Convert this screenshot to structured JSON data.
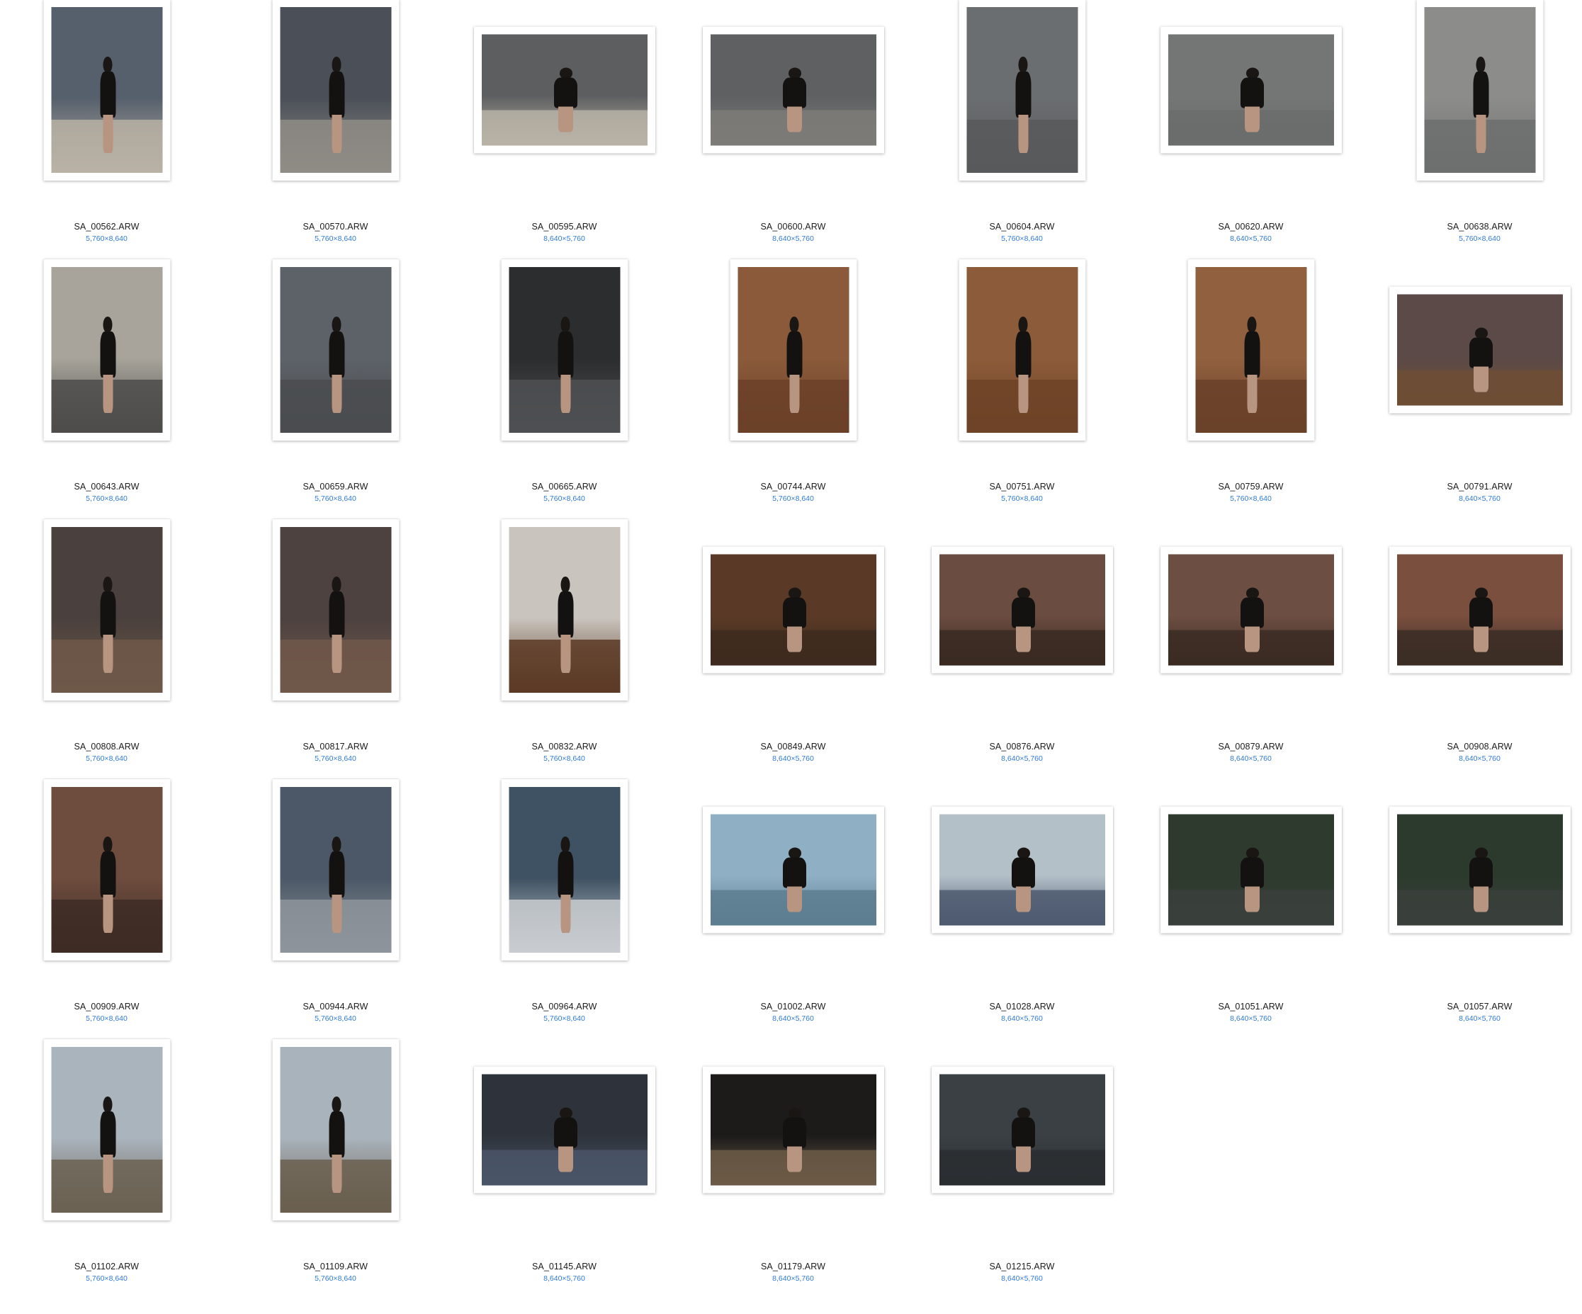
{
  "files": [
    {
      "name": "SA_00562.ARW",
      "dimensions": "5,760×8,640",
      "orientation": "portrait",
      "palette": [
        "#56606c",
        "#b9b2a5"
      ]
    },
    {
      "name": "SA_00570.ARW",
      "dimensions": "5,760×8,640",
      "orientation": "portrait",
      "palette": [
        "#4b5058",
        "#8f8c86"
      ]
    },
    {
      "name": "SA_00595.ARW",
      "dimensions": "8,640×5,760",
      "orientation": "landscape",
      "palette": [
        "#5d5e60",
        "#b9b3a7"
      ]
    },
    {
      "name": "SA_00600.ARW",
      "dimensions": "8,640×5,760",
      "orientation": "landscape",
      "palette": [
        "#5e6062",
        "#7c7b78"
      ]
    },
    {
      "name": "SA_00604.ARW",
      "dimensions": "5,760×8,640",
      "orientation": "portrait",
      "palette": [
        "#6b6e70",
        "#58595a"
      ]
    },
    {
      "name": "SA_00620.ARW",
      "dimensions": "8,640×5,760",
      "orientation": "landscape",
      "palette": [
        "#747675",
        "#6b6c6c"
      ]
    },
    {
      "name": "SA_00638.ARW",
      "dimensions": "5,760×8,640",
      "orientation": "portrait",
      "palette": [
        "#8c8d8b",
        "#6d6e6e"
      ]
    },
    {
      "name": "SA_00643.ARW",
      "dimensions": "5,760×8,640",
      "orientation": "portrait",
      "palette": [
        "#a8a49b",
        "#4d4c4b"
      ]
    },
    {
      "name": "SA_00659.ARW",
      "dimensions": "5,760×8,640",
      "orientation": "portrait",
      "palette": [
        "#5d6268",
        "#4a4c4f"
      ]
    },
    {
      "name": "SA_00665.ARW",
      "dimensions": "5,760×8,640",
      "orientation": "portrait",
      "palette": [
        "#2c2d2e",
        "#4e5052"
      ]
    },
    {
      "name": "SA_00744.ARW",
      "dimensions": "5,760×8,640",
      "orientation": "portrait",
      "palette": [
        "#8a5a3a",
        "#6b4128"
      ]
    },
    {
      "name": "SA_00751.ARW",
      "dimensions": "5,760×8,640",
      "orientation": "portrait",
      "palette": [
        "#8c5b3a",
        "#6e4327"
      ]
    },
    {
      "name": "SA_00759.ARW",
      "dimensions": "5,760×8,640",
      "orientation": "portrait",
      "palette": [
        "#91603f",
        "#6a4129"
      ]
    },
    {
      "name": "SA_00791.ARW",
      "dimensions": "8,640×5,760",
      "orientation": "landscape",
      "palette": [
        "#5b4a48",
        "#6e4d35"
      ]
    },
    {
      "name": "SA_00808.ARW",
      "dimensions": "5,760×8,640",
      "orientation": "portrait",
      "palette": [
        "#4a403d",
        "#6e5849"
      ]
    },
    {
      "name": "SA_00817.ARW",
      "dimensions": "5,760×8,640",
      "orientation": "portrait",
      "palette": [
        "#4d4240",
        "#70584a"
      ]
    },
    {
      "name": "SA_00832.ARW",
      "dimensions": "5,760×8,640",
      "orientation": "portrait",
      "palette": [
        "#c9c4bd",
        "#5c3a25"
      ]
    },
    {
      "name": "SA_00849.ARW",
      "dimensions": "8,640×5,760",
      "orientation": "landscape",
      "palette": [
        "#5a3a26",
        "#3e2a1e"
      ]
    },
    {
      "name": "SA_00876.ARW",
      "dimensions": "8,640×5,760",
      "orientation": "landscape",
      "palette": [
        "#6b4c40",
        "#3a2a22"
      ]
    },
    {
      "name": "SA_00879.ARW",
      "dimensions": "8,640×5,760",
      "orientation": "landscape",
      "palette": [
        "#6d4e42",
        "#3b2b23"
      ]
    },
    {
      "name": "SA_00908.ARW",
      "dimensions": "8,640×5,760",
      "orientation": "landscape",
      "palette": [
        "#7a4f3e",
        "#3b2d25"
      ]
    },
    {
      "name": "SA_00909.ARW",
      "dimensions": "5,760×8,640",
      "orientation": "portrait",
      "palette": [
        "#6e4c3e",
        "#3d2c24"
      ]
    },
    {
      "name": "SA_00944.ARW",
      "dimensions": "5,760×8,640",
      "orientation": "portrait",
      "palette": [
        "#4c5867",
        "#8e949b"
      ]
    },
    {
      "name": "SA_00964.ARW",
      "dimensions": "5,760×8,640",
      "orientation": "portrait",
      "palette": [
        "#3f5263",
        "#c9ccd0"
      ]
    },
    {
      "name": "SA_01002.ARW",
      "dimensions": "8,640×5,760",
      "orientation": "landscape",
      "palette": [
        "#8fb0c4",
        "#5d7c90"
      ]
    },
    {
      "name": "SA_01028.ARW",
      "dimensions": "8,640×5,760",
      "orientation": "landscape",
      "palette": [
        "#b4c0c8",
        "#4d5a70"
      ]
    },
    {
      "name": "SA_01051.ARW",
      "dimensions": "8,640×5,760",
      "orientation": "landscape",
      "palette": [
        "#2d3a2d",
        "#3a3f3c"
      ]
    },
    {
      "name": "SA_01057.ARW",
      "dimensions": "8,640×5,760",
      "orientation": "landscape",
      "palette": [
        "#2c3a2d",
        "#393f3b"
      ]
    },
    {
      "name": "SA_01102.ARW",
      "dimensions": "5,760×8,640",
      "orientation": "portrait",
      "palette": [
        "#aab4bd",
        "#6b6152"
      ]
    },
    {
      "name": "SA_01109.ARW",
      "dimensions": "5,760×8,640",
      "orientation": "portrait",
      "palette": [
        "#a9b3bc",
        "#6a5f4f"
      ]
    },
    {
      "name": "SA_01145.ARW",
      "dimensions": "8,640×5,760",
      "orientation": "landscape",
      "palette": [
        "#2e333b",
        "#4a5567"
      ]
    },
    {
      "name": "SA_01179.ARW",
      "dimensions": "8,640×5,760",
      "orientation": "landscape",
      "palette": [
        "#1c1b1a",
        "#6c5a46"
      ]
    },
    {
      "name": "SA_01215.ARW",
      "dimensions": "8,640×5,760",
      "orientation": "landscape",
      "palette": [
        "#3a4044",
        "#2a2e31"
      ]
    }
  ]
}
